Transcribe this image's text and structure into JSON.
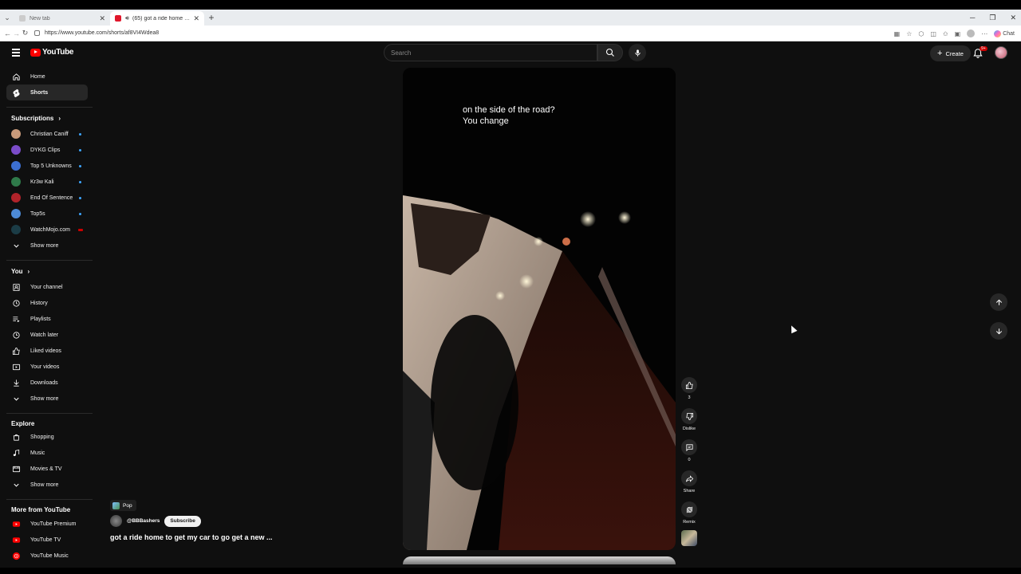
{
  "browser": {
    "tabs": [
      {
        "label": "New tab",
        "active": false
      },
      {
        "label": "(65) got a ride home to get m",
        "active": true
      }
    ],
    "url": "https://www.youtube.com/shorts/af8VI4Wdea8",
    "copilot_label": "Chat"
  },
  "header": {
    "logo_text": "YouTube",
    "search_placeholder": "Search",
    "create_label": "Create",
    "notification_badge": "9+"
  },
  "sidebar": {
    "main": [
      {
        "label": "Home",
        "icon": "home-icon"
      },
      {
        "label": "Shorts",
        "icon": "shorts-icon",
        "active": true
      }
    ],
    "subscriptions_heading": "Subscriptions",
    "subscriptions": [
      {
        "label": "Christian Caniff",
        "color": "#c99a7a",
        "indicator": "dot"
      },
      {
        "label": "DYKG Clips",
        "color": "#7b4cc9",
        "indicator": "dot"
      },
      {
        "label": "Top 5 Unknowns",
        "color": "#3c6fd1",
        "indicator": "dot"
      },
      {
        "label": "Kr3w Kali",
        "color": "#2f7a4a",
        "indicator": "dot"
      },
      {
        "label": "End Of Sentence",
        "color": "#b0232a",
        "indicator": "dot"
      },
      {
        "label": "Top5s",
        "color": "#4d8ad6",
        "indicator": "dot"
      },
      {
        "label": "WatchMojo.com",
        "color": "#1b3c46",
        "indicator": "live"
      }
    ],
    "subscriptions_more": "Show more",
    "you_heading": "You",
    "you": [
      {
        "label": "Your channel",
        "icon": "channel-icon"
      },
      {
        "label": "History",
        "icon": "history-icon"
      },
      {
        "label": "Playlists",
        "icon": "playlists-icon"
      },
      {
        "label": "Watch later",
        "icon": "watch-later-icon"
      },
      {
        "label": "Liked videos",
        "icon": "liked-icon"
      },
      {
        "label": "Your videos",
        "icon": "your-videos-icon"
      },
      {
        "label": "Downloads",
        "icon": "download-icon"
      }
    ],
    "you_more": "Show more",
    "explore_heading": "Explore",
    "explore": [
      {
        "label": "Shopping",
        "icon": "shopping-icon"
      },
      {
        "label": "Music",
        "icon": "music-icon"
      },
      {
        "label": "Movies & TV",
        "icon": "movies-icon"
      }
    ],
    "explore_more": "Show more",
    "more_heading": "More from YouTube",
    "more": [
      {
        "label": "YouTube Premium",
        "icon": "yt-premium-icon"
      },
      {
        "label": "YouTube TV",
        "icon": "yt-tv-icon"
      },
      {
        "label": "YouTube Music",
        "icon": "yt-music-icon"
      }
    ]
  },
  "short": {
    "caption": "on the side of the road?\nYou change",
    "tag": "Pop",
    "channel": "@BBBashers",
    "subscribe_label": "Subscribe",
    "title": "got a ride home to get my car to go get a new ...",
    "actions": {
      "like_count": "3",
      "dislike_label": "Dislike",
      "comment_count": "0",
      "share_label": "Share",
      "remix_label": "Remix"
    }
  }
}
